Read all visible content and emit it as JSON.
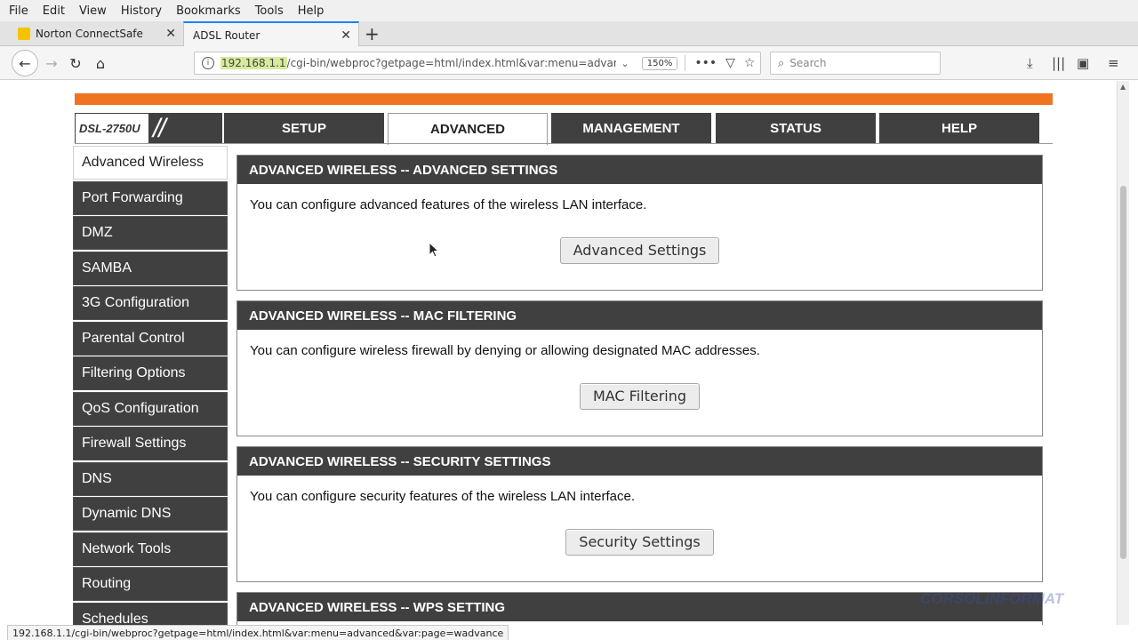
{
  "menubar": [
    "File",
    "Edit",
    "View",
    "History",
    "Bookmarks",
    "Tools",
    "Help"
  ],
  "tabs": [
    {
      "label": "Norton ConnectSafe",
      "active": false
    },
    {
      "label": "ADSL Router",
      "active": true
    }
  ],
  "navbar": {
    "url_host": "192.168.1.1",
    "url_path": "/cgi-bin/webproc?getpage=html/index.html&var:menu=advanced&",
    "zoom": "150%",
    "search_placeholder": "Search"
  },
  "router": {
    "model": "DSL-2750U",
    "top_tabs": [
      {
        "label": "SETUP",
        "active": false
      },
      {
        "label": "ADVANCED",
        "active": true
      },
      {
        "label": "MANAGEMENT",
        "active": false
      },
      {
        "label": "STATUS",
        "active": false
      },
      {
        "label": "HELP",
        "active": false
      }
    ],
    "sidebar": [
      {
        "label": "Advanced Wireless",
        "active": true
      },
      {
        "label": "Port Forwarding"
      },
      {
        "label": "DMZ"
      },
      {
        "label": "SAMBA"
      },
      {
        "label": "3G Configuration"
      },
      {
        "label": "Parental Control"
      },
      {
        "label": "Filtering Options"
      },
      {
        "label": "QoS Configuration"
      },
      {
        "label": "Firewall Settings"
      },
      {
        "label": "DNS"
      },
      {
        "label": "Dynamic DNS"
      },
      {
        "label": "Network Tools"
      },
      {
        "label": "Routing"
      },
      {
        "label": "Schedules"
      }
    ],
    "panels": [
      {
        "title": "ADVANCED WIRELESS -- ADVANCED SETTINGS",
        "text": "You can configure advanced features of the wireless LAN interface.",
        "button": "Advanced Settings"
      },
      {
        "title": "ADVANCED WIRELESS -- MAC FILTERING",
        "text": "You can configure wireless firewall by denying or allowing designated MAC addresses.",
        "button": "MAC Filtering"
      },
      {
        "title": "ADVANCED WIRELESS -- SECURITY SETTINGS",
        "text": "You can configure security features of the wireless LAN interface.",
        "button": "Security Settings"
      },
      {
        "title": "ADVANCED WIRELESS -- WPS SETTING"
      }
    ]
  },
  "status_url": "192.168.1.1/cgi-bin/webproc?getpage=html/index.html&var:menu=advanced&var:page=wadvance",
  "watermark": "CORSOLINFORMAT"
}
